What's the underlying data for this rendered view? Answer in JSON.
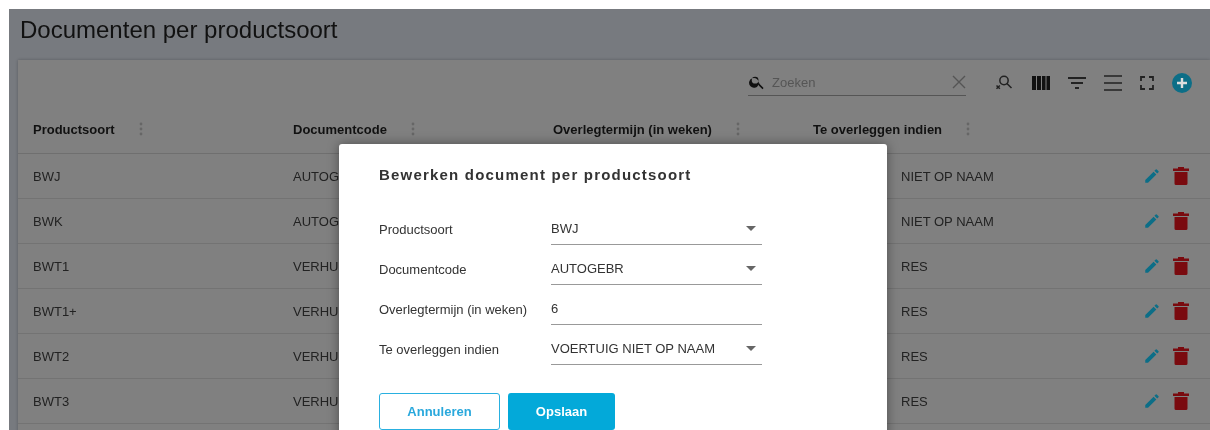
{
  "page": {
    "title": "Documenten per productsoort"
  },
  "toolbar": {
    "search": {
      "placeholder": "Zoeken"
    }
  },
  "table": {
    "columns": [
      "Productsoort",
      "Documentcode",
      "Overlegtermijn (in weken)",
      "Te overleggen indien"
    ],
    "rows": [
      {
        "productsoort": "BWJ",
        "documentcode": "AUTOG",
        "te_overleggen_indien": "NIET OP NAAM"
      },
      {
        "productsoort": "BWK",
        "documentcode": "AUTOG",
        "te_overleggen_indien": "NIET OP NAAM"
      },
      {
        "productsoort": "BWT1",
        "documentcode": "VERHU",
        "te_overleggen_indien": "RES"
      },
      {
        "productsoort": "BWT1+",
        "documentcode": "VERHU",
        "te_overleggen_indien": "RES"
      },
      {
        "productsoort": "BWT2",
        "documentcode": "VERHU",
        "te_overleggen_indien": "RES"
      },
      {
        "productsoort": "BWT3",
        "documentcode": "VERHU",
        "te_overleggen_indien": "RES"
      }
    ]
  },
  "dialog": {
    "title": "Bewerken document per productsoort",
    "fields": [
      {
        "label": "Productsoort",
        "value": "BWJ",
        "kind": "select"
      },
      {
        "label": "Documentcode",
        "value": "AUTOGEBR",
        "kind": "select"
      },
      {
        "label": "Overlegtermijn (in weken)",
        "value": "6",
        "kind": "text"
      },
      {
        "label": "Te overleggen indien",
        "value": "VOERTUIG NIET OP NAAM",
        "kind": "select"
      }
    ],
    "buttons": [
      {
        "label": "Annuleren",
        "kind": "outline"
      },
      {
        "label": "Opslaan",
        "kind": "primary"
      }
    ]
  }
}
